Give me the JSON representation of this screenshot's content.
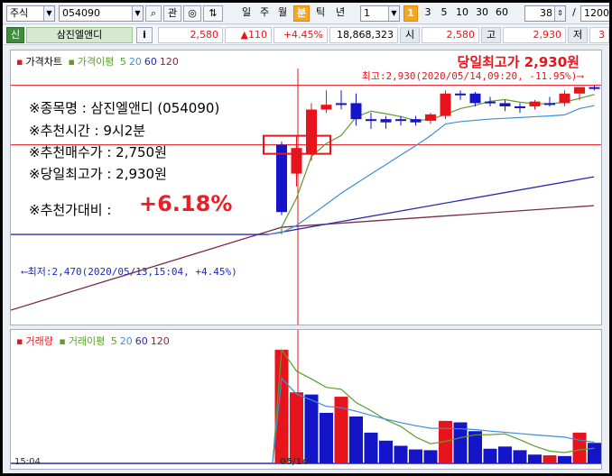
{
  "toolbar": {
    "market_select": "주식",
    "code_input": "054090",
    "btn_search": "⌕",
    "btn_watch": "관",
    "btn_updown": "⇅",
    "period_tabs": [
      "일",
      "주",
      "월",
      "분",
      "틱",
      "년"
    ],
    "active_period": "분",
    "interval_value": "1",
    "interval_active": "1",
    "interval_options": [
      "3",
      "5",
      "10",
      "30",
      "60"
    ],
    "count_value": "38",
    "slash": "/",
    "total_value": "1200"
  },
  "quote": {
    "credit_badge": "신",
    "stock_name": "삼진엘앤디",
    "info_btn": "i",
    "price": "2,580",
    "change": "▲110",
    "change_pct": "+4.45%",
    "volume": "18,868,323",
    "open_label": "시",
    "open_value": "2,580",
    "high_label": "고",
    "high_value": "2,930",
    "low_label": "저",
    "low_value": "3"
  },
  "price_pane": {
    "legend_title": "가격차트",
    "legend_ma_title": "가격이평",
    "ma_periods": [
      "5",
      "20",
      "60",
      "120"
    ],
    "high_banner": "당일최고가 2,930원",
    "high_marker": "최고:2,930(2020/05/14,09:20, -11.95%)⟶",
    "low_marker": "⟵최저:2,470(2020/05/13,15:04, +4.45%)",
    "info_lines": [
      "※종목명 : 삼진엘앤디 (054090)",
      "※추천시간 : 9시2분",
      "※추천매수가 : 2,750원",
      "※당일최고가 : 2,930원"
    ],
    "ratio_label": "※추천가대비 :",
    "ratio_value": "+6.18%"
  },
  "volume_pane": {
    "legend_title": "거래량",
    "legend_ma_title": "거래이평",
    "ma_periods": [
      "5",
      "20",
      "60",
      "120"
    ],
    "x_labels": [
      "15:04",
      "05/14"
    ]
  },
  "colors": {
    "up": "#e8141c",
    "down": "#1414c8",
    "ma5": "#5a9e2a",
    "ma20": "#3c8fd8",
    "ma60": "#2a2ab0",
    "ma120": "#7a2a4a"
  },
  "chart_data": {
    "type": "bar",
    "candles": [
      {
        "o": 2750,
        "h": 2760,
        "l": 2530,
        "c": 2540,
        "dir": "down"
      },
      {
        "o": 2660,
        "h": 2780,
        "l": 2620,
        "c": 2740,
        "dir": "up"
      },
      {
        "o": 2720,
        "h": 2880,
        "l": 2700,
        "c": 2860,
        "dir": "up"
      },
      {
        "o": 2860,
        "h": 2920,
        "l": 2850,
        "c": 2875,
        "dir": "up"
      },
      {
        "o": 2880,
        "h": 2920,
        "l": 2860,
        "c": 2880,
        "dir": "doji"
      },
      {
        "o": 2880,
        "h": 2910,
        "l": 2810,
        "c": 2830,
        "dir": "down"
      },
      {
        "o": 2830,
        "h": 2850,
        "l": 2800,
        "c": 2830,
        "dir": "doji"
      },
      {
        "o": 2830,
        "h": 2840,
        "l": 2800,
        "c": 2820,
        "dir": "down"
      },
      {
        "o": 2830,
        "h": 2840,
        "l": 2810,
        "c": 2830,
        "dir": "doji"
      },
      {
        "o": 2830,
        "h": 2840,
        "l": 2810,
        "c": 2820,
        "dir": "down"
      },
      {
        "o": 2825,
        "h": 2850,
        "l": 2815,
        "c": 2845,
        "dir": "up"
      },
      {
        "o": 2840,
        "h": 2920,
        "l": 2830,
        "c": 2910,
        "dir": "up"
      },
      {
        "o": 2910,
        "h": 2920,
        "l": 2890,
        "c": 2910,
        "dir": "doji"
      },
      {
        "o": 2910,
        "h": 2915,
        "l": 2870,
        "c": 2880,
        "dir": "down"
      },
      {
        "o": 2880,
        "h": 2900,
        "l": 2870,
        "c": 2885,
        "dir": "doji"
      },
      {
        "o": 2880,
        "h": 2890,
        "l": 2855,
        "c": 2870,
        "dir": "doji"
      },
      {
        "o": 2865,
        "h": 2880,
        "l": 2850,
        "c": 2870,
        "dir": "down"
      },
      {
        "o": 2870,
        "h": 2890,
        "l": 2860,
        "c": 2885,
        "dir": "up"
      },
      {
        "o": 2880,
        "h": 2900,
        "l": 2870,
        "c": 2880,
        "dir": "doji"
      },
      {
        "o": 2880,
        "h": 2920,
        "l": 2870,
        "c": 2910,
        "dir": "up"
      },
      {
        "o": 2910,
        "h": 2930,
        "l": 2890,
        "c": 2930,
        "dir": "up"
      },
      {
        "o": 2930,
        "h": 2935,
        "l": 2920,
        "c": 2930,
        "dir": "doji"
      }
    ],
    "volumes": [
      {
        "v": 1550,
        "dir": "up"
      },
      {
        "v": 970,
        "dir": "up"
      },
      {
        "v": 940,
        "dir": "down"
      },
      {
        "v": 690,
        "dir": "down"
      },
      {
        "v": 910,
        "dir": "up"
      },
      {
        "v": 640,
        "dir": "down"
      },
      {
        "v": 420,
        "dir": "down"
      },
      {
        "v": 310,
        "dir": "down"
      },
      {
        "v": 240,
        "dir": "down"
      },
      {
        "v": 190,
        "dir": "down"
      },
      {
        "v": 180,
        "dir": "down"
      },
      {
        "v": 580,
        "dir": "up"
      },
      {
        "v": 560,
        "dir": "down"
      },
      {
        "v": 440,
        "dir": "down"
      },
      {
        "v": 200,
        "dir": "down"
      },
      {
        "v": 230,
        "dir": "down"
      },
      {
        "v": 180,
        "dir": "down"
      },
      {
        "v": 120,
        "dir": "down"
      },
      {
        "v": 110,
        "dir": "up"
      },
      {
        "v": 100,
        "dir": "down"
      },
      {
        "v": 420,
        "dir": "up"
      },
      {
        "v": 280,
        "dir": "down"
      }
    ],
    "price_ylim": [
      2200,
      2960
    ],
    "volume_ylim": [
      0,
      1600
    ]
  }
}
